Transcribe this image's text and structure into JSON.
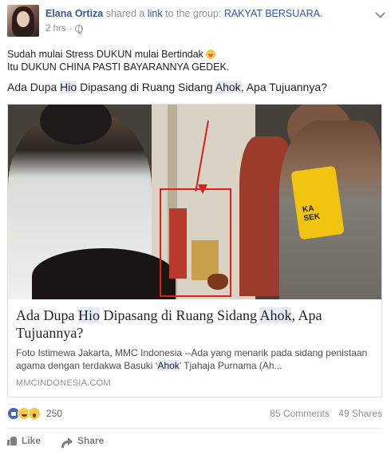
{
  "post": {
    "author": "Elana Ortiza",
    "shared_text": "shared a",
    "link_word": "link",
    "to_text": "to the group:",
    "group": "RAKYAT BERSUARA.",
    "time": "2 hrs",
    "dot": "·",
    "line1": "Sudah mulai Stress DUKUN mulai Bertindak",
    "line2": "Itu DUKUN CHINA PASTI BAYARANNYA GEDEK.",
    "q_part1": "Ada Dupa ",
    "q_hl1": "Hio",
    "q_part2": " Dipasang di Ruang Sidang ",
    "q_hl2": "Ahok",
    "q_part3": ", Apa Tujuannya?"
  },
  "card": {
    "title_part1": "Ada Dupa ",
    "title_hl1": "Hio",
    "title_part2": " Dipasang di Ruang Sidang ",
    "title_hl2": "Ahok",
    "title_part3": ", Apa Tujuannya?",
    "desc_part1": "Foto Istimewa Jakarta, MMC Indonesia --Ada yang menarik pada sidang penistaan agama dengan terdakwa Basuki ‘",
    "desc_hl": "Ahok",
    "desc_part2": "’ Tjahaja Purnama (Ah...",
    "domain": "MMCINDONESIA.COM",
    "armband_text": "KA\nSEK"
  },
  "stats": {
    "reactions_count": "250",
    "comments": "85 Comments",
    "shares": "49 Shares"
  },
  "actions": {
    "like": "Like",
    "share": "Share"
  },
  "icons": {
    "reactions": [
      "like-icon",
      "haha-icon",
      "wow-icon"
    ],
    "privacy": "globe-icon",
    "menu": "chevron-down-icon"
  }
}
